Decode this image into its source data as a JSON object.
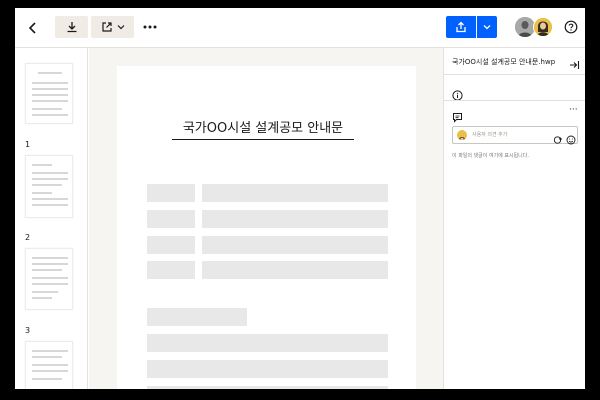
{
  "toolbar": {
    "back_icon": "chevron-left-icon",
    "download_icon": "download-icon",
    "open_icon": "open-external-icon",
    "more_icon": "more-horizontal-icon",
    "share_icon": "share-icon",
    "help_icon": "help-icon",
    "accent_color": "#0061fe"
  },
  "thumbnails": [
    {
      "page": "1"
    },
    {
      "page": "2"
    },
    {
      "page": "3"
    }
  ],
  "document": {
    "title": "국가OO시설 설계공모 안내문"
  },
  "panel": {
    "file_name": "국가OO시설 설계공모 안내문.hwp",
    "comment_placeholder": "사용자 의견 추가",
    "empty_message": "이 파일의 댓글이 여기에 표시됩니다.",
    "comment_more": "···"
  }
}
